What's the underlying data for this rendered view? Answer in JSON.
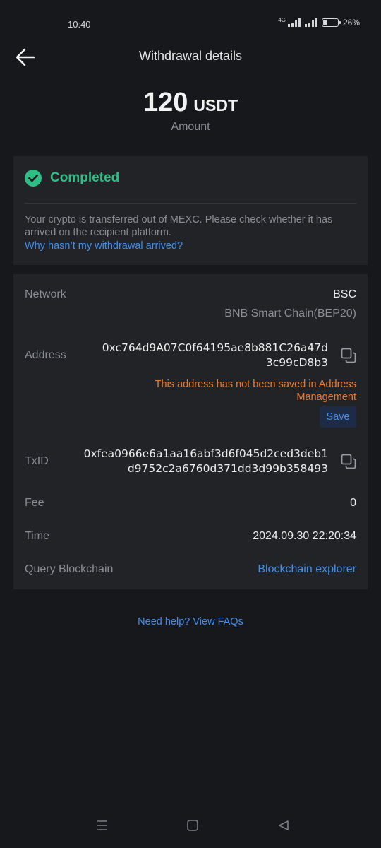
{
  "status_bar": {
    "time": "10:40",
    "network": "4G",
    "battery": "26%",
    "battery_level": 0.26
  },
  "header": {
    "title": "Withdrawal details",
    "back_icon": "arrow-left-icon"
  },
  "amount": {
    "value": "120",
    "unit": "USDT",
    "caption": "Amount"
  },
  "status": {
    "label": "Completed",
    "color": "#2dbd85",
    "message": "Your crypto is transferred out of MEXC. Please check whether it has arrived on the recipient platform.",
    "help_link": "Why hasn’t my withdrawal arrived?"
  },
  "details": {
    "network_label": "Network",
    "network_value": "BSC",
    "network_sub": "BNB Smart Chain(BEP20)",
    "address_label": "Address",
    "address_line1": "0xc764d9A07C0f64195ae8b881C26a47d",
    "address_line2": "3c99cD8b3",
    "address_warning_line1": "This address has not been saved in Address",
    "address_warning_line2": "Management",
    "save_label": "Save",
    "txid_label": "TxID",
    "txid_line1": "0xfea0966e6a1aa16abf3d6f045d2ced3deb1",
    "txid_line2": "d9752c2a6760d371dd3d99b358493",
    "fee_label": "Fee",
    "fee_value": "0",
    "time_label": "Time",
    "time_value": "2024.09.30 22:20:34",
    "query_label": "Query Blockchain",
    "query_link": "Blockchain explorer"
  },
  "footer": {
    "faq_link": "Need help? View FAQs"
  },
  "colors": {
    "background": "#17181b",
    "card": "#222327",
    "accent": "#3d8ff0",
    "warning": "#f07a2a",
    "success": "#2dbd85"
  }
}
